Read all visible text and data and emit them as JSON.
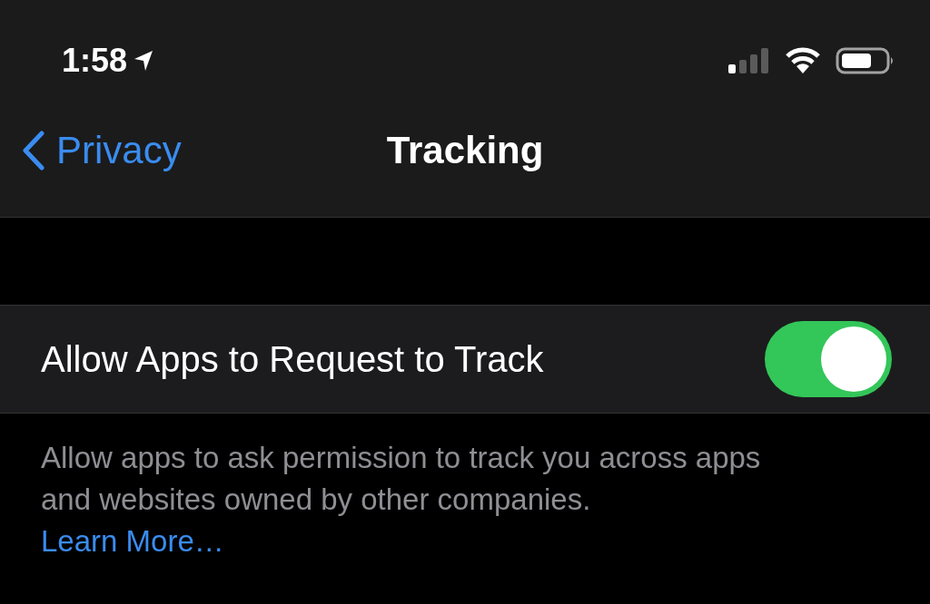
{
  "status_bar": {
    "time": "1:58"
  },
  "nav": {
    "back": "Privacy",
    "title": "Tracking"
  },
  "settings": [
    {
      "label": "Allow Apps to Request to Track",
      "on": true
    }
  ],
  "footer": {
    "text": "Allow apps to ask permission to track you across apps and websites owned by other companies.",
    "link": "Learn More…"
  }
}
